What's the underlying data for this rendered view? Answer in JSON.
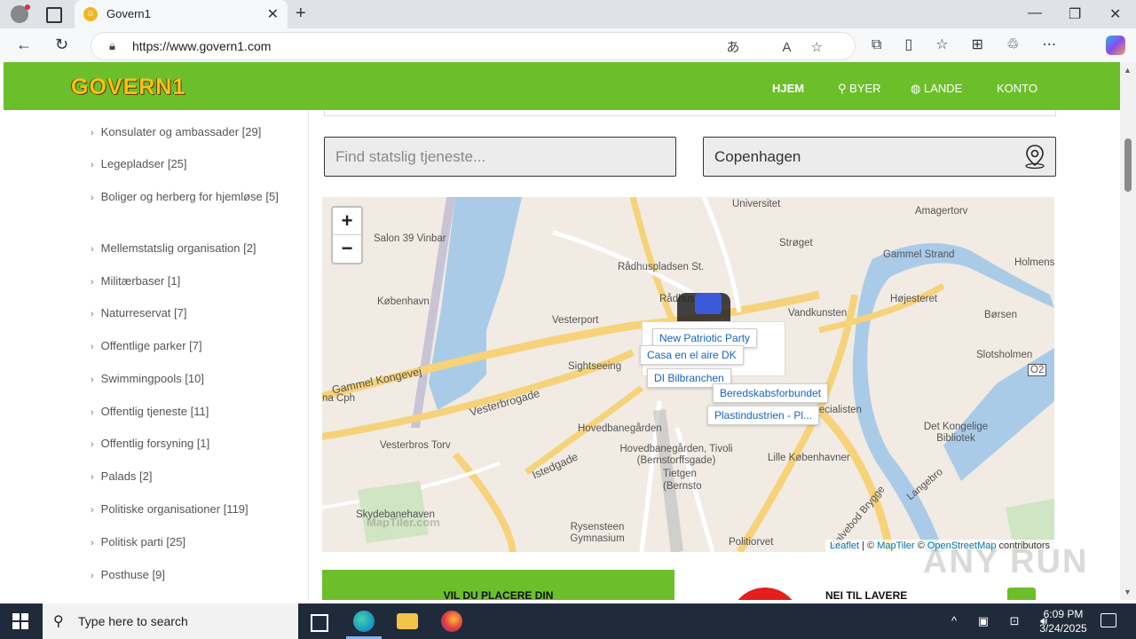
{
  "browser": {
    "tab_title": "Govern1",
    "url": "https://www.govern1.com",
    "new_tab_glyph": "+",
    "close_glyph": "✕"
  },
  "site": {
    "logo": "GOVERN1",
    "nav": [
      {
        "label": "HJEM",
        "icon": "home"
      },
      {
        "label": "BYER",
        "icon": "pin-icon"
      },
      {
        "label": "LANDE",
        "icon": "globe-icon"
      },
      {
        "label": "KONTO",
        "icon": ""
      }
    ],
    "categories": [
      "Konsulater og ambassader [29]",
      "Legepladser [25]",
      "Boliger og herberg for hjemløse [5]",
      "Mellemstatslig organisation [2]",
      "Militærbaser [1]",
      "Naturreservat [7]",
      "Offentlige parker [7]",
      "Swimmingpools [10]",
      "Offentlig tjeneste [11]",
      "Offentlig forsyning [1]",
      "Palads [2]",
      "Politiske organisationer [119]",
      "Politisk parti [25]",
      "Posthuse [9]"
    ],
    "search_placeholder": "Find statslig tjeneste...",
    "city_value": "Copenhagen",
    "map": {
      "zoom_in": "+",
      "zoom_out": "−",
      "labels": [
        "Universitet",
        "Amagertorv",
        "Salon 39 Vinbar",
        "Strøget",
        "Gammel Strand",
        "Holmens K",
        "Rådhuspladsen St.",
        "Rådhus",
        "Vandkunsten",
        "Højesteret",
        "Børsen",
        "København",
        "Vesterport",
        "Slotsholmen",
        "Sightseeing",
        "Gammel Kongevej",
        "Vesterbrogade",
        "Hovedbanegården",
        "Hovedbanegården, Tivoli (Bernstorffsgade)",
        "Lille Københavner",
        "Det Kongelige Bibliotek",
        "Vesterbros Torv",
        "Istedgade",
        "Tietgen (Bernsto",
        "Skydebanehaven",
        "Rysensteen Gymnasium",
        "Politiorvet",
        "Kalvebod Brygge",
        "Langebro",
        "na Cph",
        "ecialisten",
        "O2"
      ],
      "pois": [
        "New Patriotic Party",
        "Casa en el aire DK",
        "DI Bilbranchen",
        "Beredskabsforbundet",
        "Plastindustrien - Pl..."
      ],
      "attribution": {
        "leaflet": "Leaflet",
        "sep": " | © ",
        "maptiler": "MapTiler",
        "sep2": " © ",
        "osm": "OpenStreetMap",
        "tail": " contributors"
      },
      "maptiler_watermark": "MapTiler.com"
    },
    "banner": "VIL DU PLACERE DIN",
    "promo": "NEI TIL LAVERE"
  },
  "taskbar": {
    "search_placeholder": "Type here to search",
    "time": "6:09 PM",
    "date": "3/24/2025"
  },
  "watermark": "ANY RUN"
}
